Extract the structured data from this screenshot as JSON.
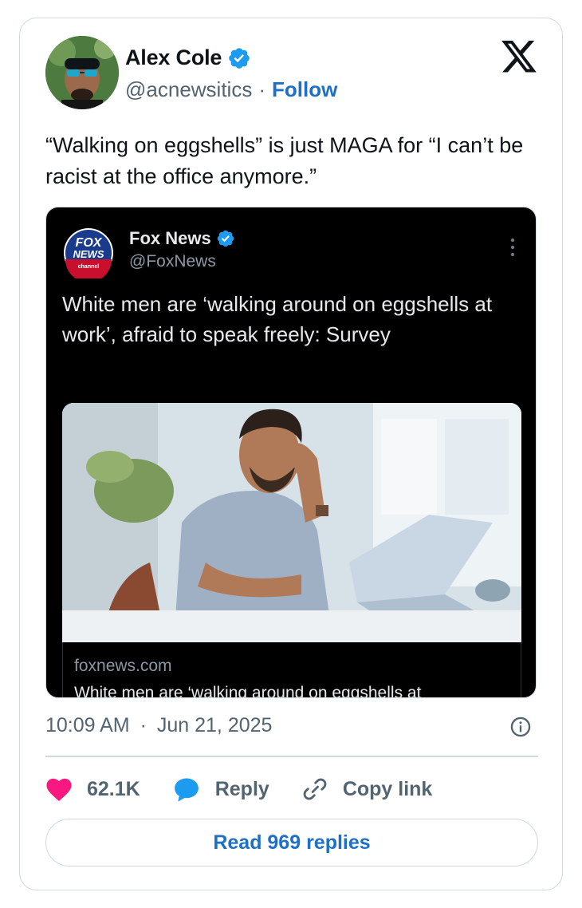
{
  "author": {
    "name": "Alex Cole",
    "handle": "@acnewsitics",
    "separator": "·",
    "follow_label": "Follow",
    "verified_color": "#1d9bf0"
  },
  "tweet": {
    "text": "“Walking on eggshells” is just MAGA for “I can’t be racist at the office anymore.”"
  },
  "embedded_post": {
    "author_name": "Fox News",
    "author_handle": "@FoxNews",
    "logo_text_top": "FOX",
    "logo_text_mid": "NEWS",
    "logo_text_bottom": "channel",
    "headline": "White men are ‘walking around on eggshells at work’, afraid to speak freely: Survey",
    "link_domain": "foxnews.com",
    "link_title": "White men are ‘walking around on eggshells at"
  },
  "meta": {
    "time": "10:09 AM",
    "separator": "·",
    "date": "Jun 21, 2025"
  },
  "actions": {
    "likes_count": "62.1K",
    "reply_label": "Reply",
    "copy_link_label": "Copy link",
    "like_color": "#f91880",
    "reply_color": "#1d9bf0"
  },
  "read_replies_label": "Read 969 replies"
}
